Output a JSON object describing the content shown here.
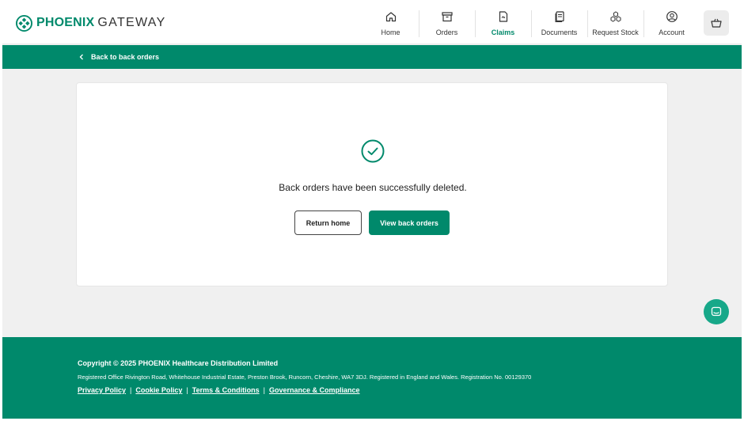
{
  "brand": {
    "name_strong": "PHOENIX",
    "name_light": "GATEWAY"
  },
  "nav": [
    {
      "label": "Home",
      "icon": "home-icon"
    },
    {
      "label": "Orders",
      "icon": "archive-box-icon"
    },
    {
      "label": "Claims",
      "icon": "claims-document-icon",
      "active": true
    },
    {
      "label": "Documents",
      "icon": "documents-icon"
    },
    {
      "label": "Request Stock",
      "icon": "boxes-stack-icon"
    },
    {
      "label": "Account",
      "icon": "user-circle-icon"
    }
  ],
  "basket": {
    "icon": "basket-icon"
  },
  "subbar": {
    "back_label": "Back to back orders"
  },
  "card": {
    "status_icon": "check-circle-icon",
    "message": "Back orders have been successfully deleted.",
    "secondary_button": "Return home",
    "primary_button": "View back orders"
  },
  "chat": {
    "icon": "chat-icon"
  },
  "footer": {
    "copyright": "Copyright © 2025 PHOENIX Healthcare Distribution Limited",
    "registered": "Registered Office Rivington Road, Whitehouse Industrial Estate, Preston Brook, Runcorn, Cheshire, WA7 3DJ. Registered in England and Wales. Registration No. 00129370",
    "links": [
      "Privacy Policy",
      "Cookie Policy",
      "Terms & Conditions",
      "Governance & Compliance"
    ],
    "separator": "|"
  },
  "colors": {
    "brand_green": "#00896b",
    "chat_green": "#17a889",
    "page_bg": "#f0f0f0"
  }
}
